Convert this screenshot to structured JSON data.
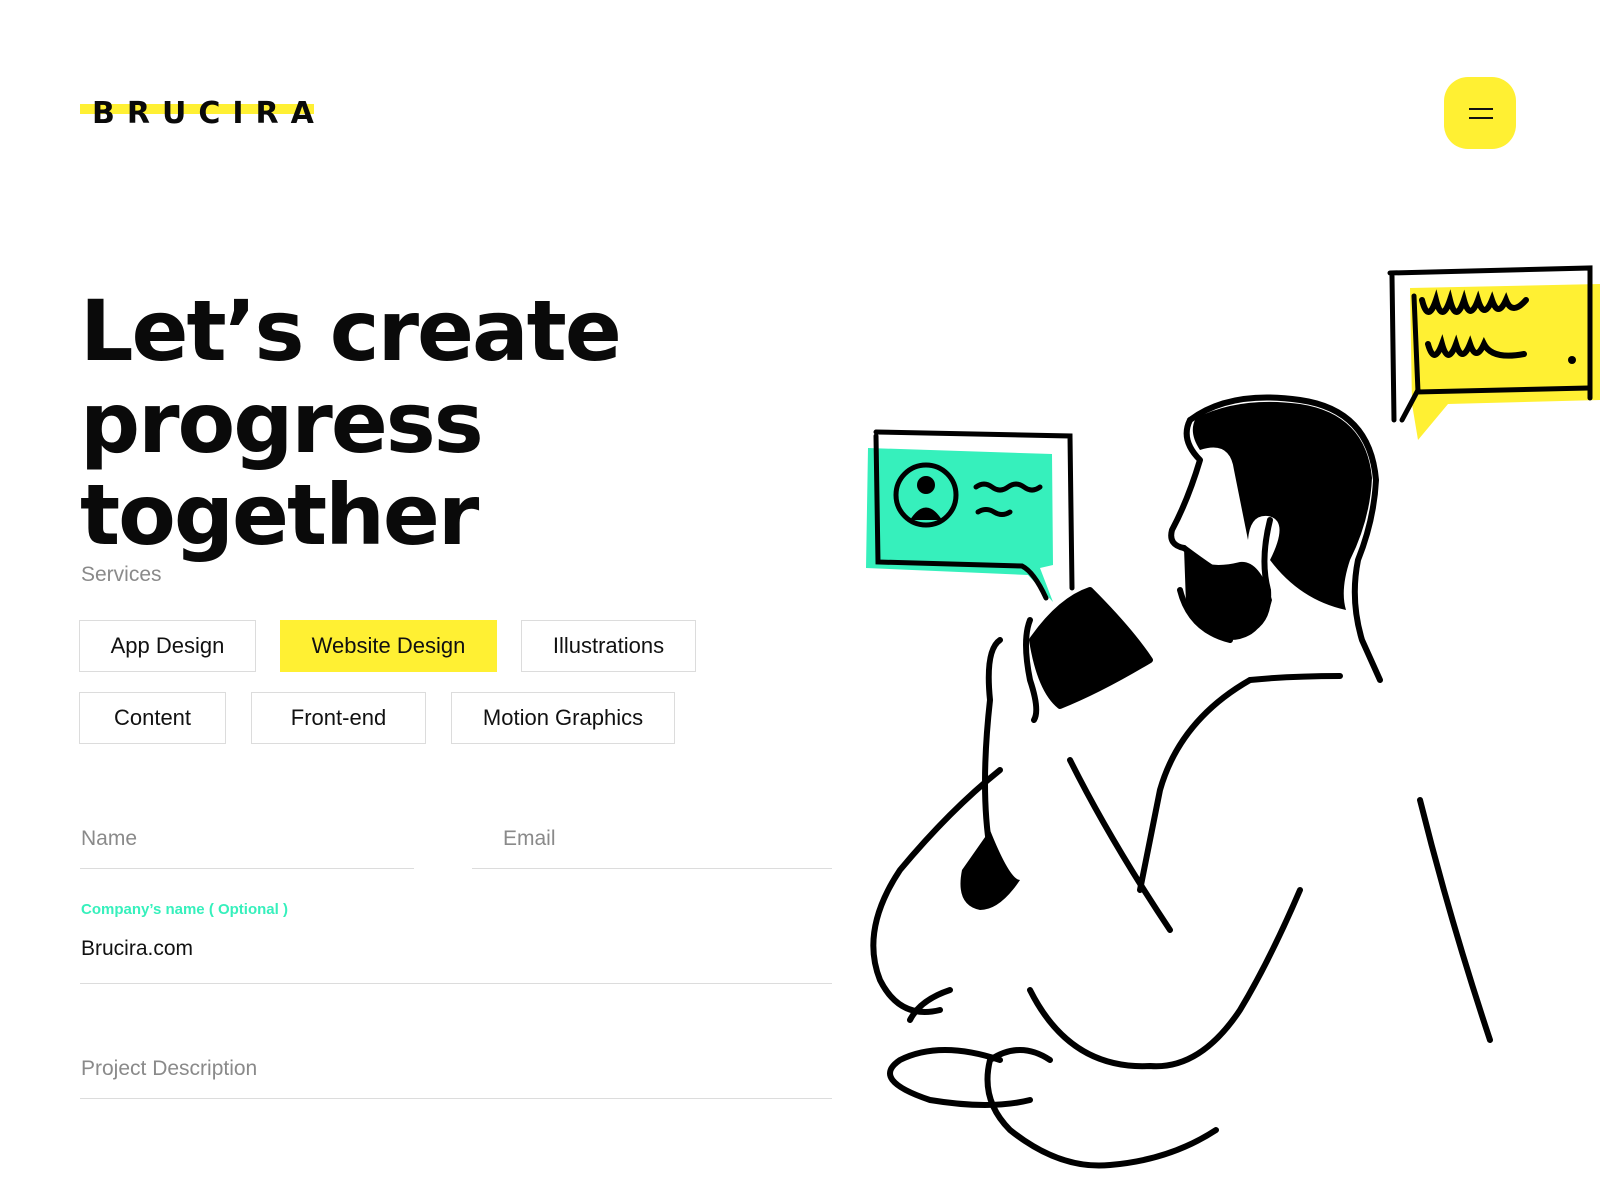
{
  "brand": {
    "name": "BRUCIRA",
    "accent": "#FFF033",
    "mint": "#36F0BC"
  },
  "header": {
    "menu_icon": "hamburger-icon"
  },
  "hero": {
    "line1": "Let’s create",
    "line2": "progress together"
  },
  "services": {
    "label": "Services",
    "options": [
      "App Design",
      "Website Design",
      "Illustrations",
      "Content",
      "Front-end",
      "Motion Graphics"
    ],
    "selected": "Website Design"
  },
  "form": {
    "name_placeholder": "Name",
    "email_placeholder": "Email",
    "company_label": "Company’s name ( Optional )",
    "company_value": "Brucira.com",
    "description_placeholder": "Project Description"
  }
}
